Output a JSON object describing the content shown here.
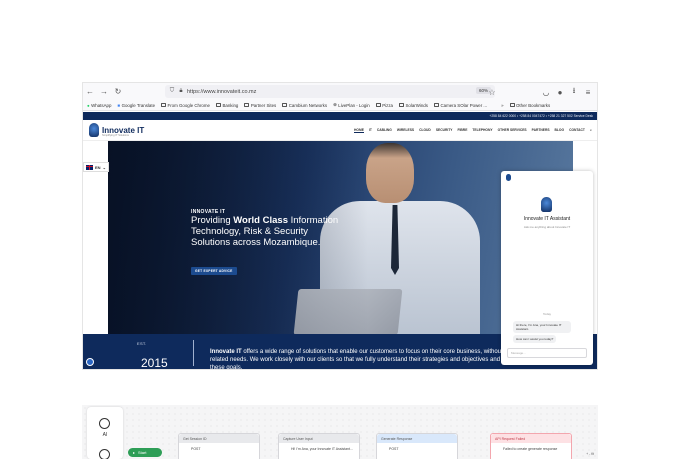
{
  "browser": {
    "url": "https://www.innovateit.co.mz",
    "zoom": "60%",
    "bookmarks": [
      "WhatsApp",
      "Google Translate",
      "From Google Chrome",
      "Banking",
      "Partner Sites",
      "Cambium Networks",
      "LivePlan - Login",
      "Pizza",
      "SolarWinds",
      "Camera SOlar Power ...",
      "Other Bookmarks"
    ]
  },
  "site": {
    "topbar_text": "+258 84 622 0000 • +258 84 0047472 • +258 21 327 502 Service Desk",
    "logo": {
      "name": "Innovate IT",
      "tagline": "Simplifying IT Solutions"
    },
    "menu": [
      "HOME",
      "IT",
      "CABLING",
      "WIRELESS",
      "CLOUD",
      "SECURITY",
      "FIBRE",
      "TELEPHONY",
      "OTHER SERVICES",
      "PARTNERS",
      "BLOG",
      "CONTACT"
    ],
    "language": "EN",
    "hero": {
      "kicker": "INNOVATE IT",
      "title_pre": "Providing ",
      "title_bold": "World Class",
      "title_rest": " Information Technology, Risk & Security Solutions across Mozambique.",
      "cta": "GET EXPERT ADVICE"
    },
    "band": {
      "est_label": "EST.",
      "year": "2015",
      "brand": "Innovate IT",
      "text": " offers a wide range of solutions that enable our customers to focus on their core business, without worrying about their technology related needs. We work closely with our clients so that we fully understand their strategies and objectives and implement systems that support these goals."
    }
  },
  "chat": {
    "name": "Innovate IT Assistant",
    "subtitle": "Ask me anything about Innovate IT",
    "day": "Today",
    "bubble1": "Hi there, I'm Ana, your Innovate IT Assistant.",
    "bubble2": "How can I assist you today?",
    "placeholder": "Message..."
  },
  "workflow": {
    "ai_label": "AI",
    "start_label": "Start",
    "nodes": [
      {
        "title": "Get Session ID",
        "body": "POST"
      },
      {
        "title": "Capture User Input",
        "body": "Hi! I'm Ana, your Innovate IT Assistant..."
      },
      {
        "title": "Generate Response",
        "body": "POST"
      },
      {
        "title": "API Request Failed",
        "body": "Failed to create generate response"
      }
    ],
    "zoom_controls": "+ - fit"
  }
}
